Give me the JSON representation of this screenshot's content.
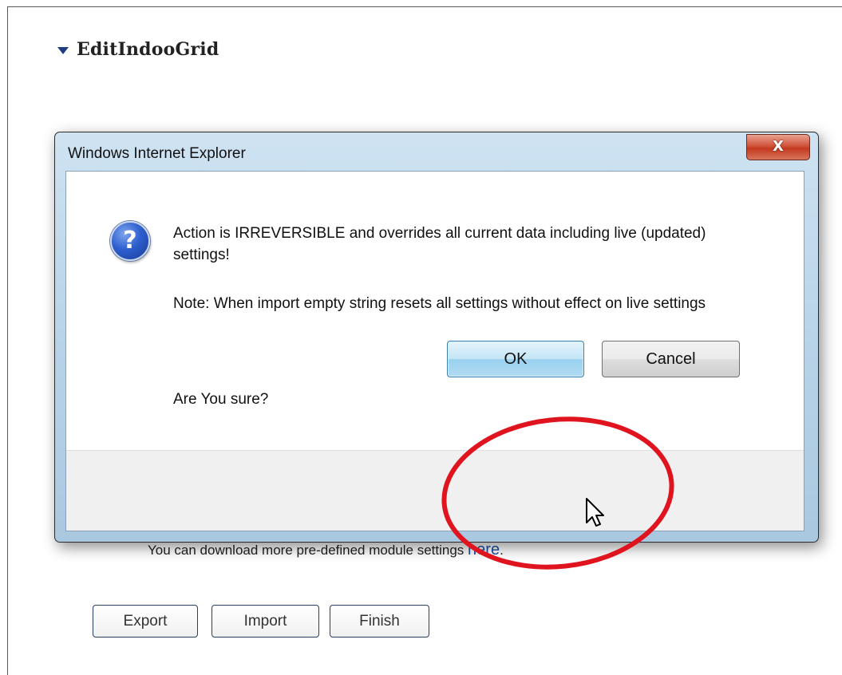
{
  "page": {
    "section_title": "EditIndooGrid",
    "download_note": "You can download more pre-defined module settings ",
    "download_link": "here",
    "download_suffix": ".",
    "buttons": {
      "export": "Export",
      "import": "Import",
      "finish": "Finish"
    }
  },
  "dialog": {
    "title": "Windows Internet Explorer",
    "close_glyph": "X",
    "icon_glyph": "?",
    "message_line1": "Action is IRREVERSIBLE and overrides all current data including live (updated) settings!",
    "message_line2": "Note: When import empty string resets all settings without effect on live settings",
    "message_line3": "Are You sure?",
    "ok_label": "OK",
    "cancel_label": "Cancel"
  },
  "colors": {
    "highlight_ring": "#e0141e",
    "link": "#1f4fa8",
    "arrow": "#1d3b82"
  },
  "icons": {
    "collapse": "triangle-down",
    "question": "question-mark",
    "cursor": "arrow-pointer"
  }
}
